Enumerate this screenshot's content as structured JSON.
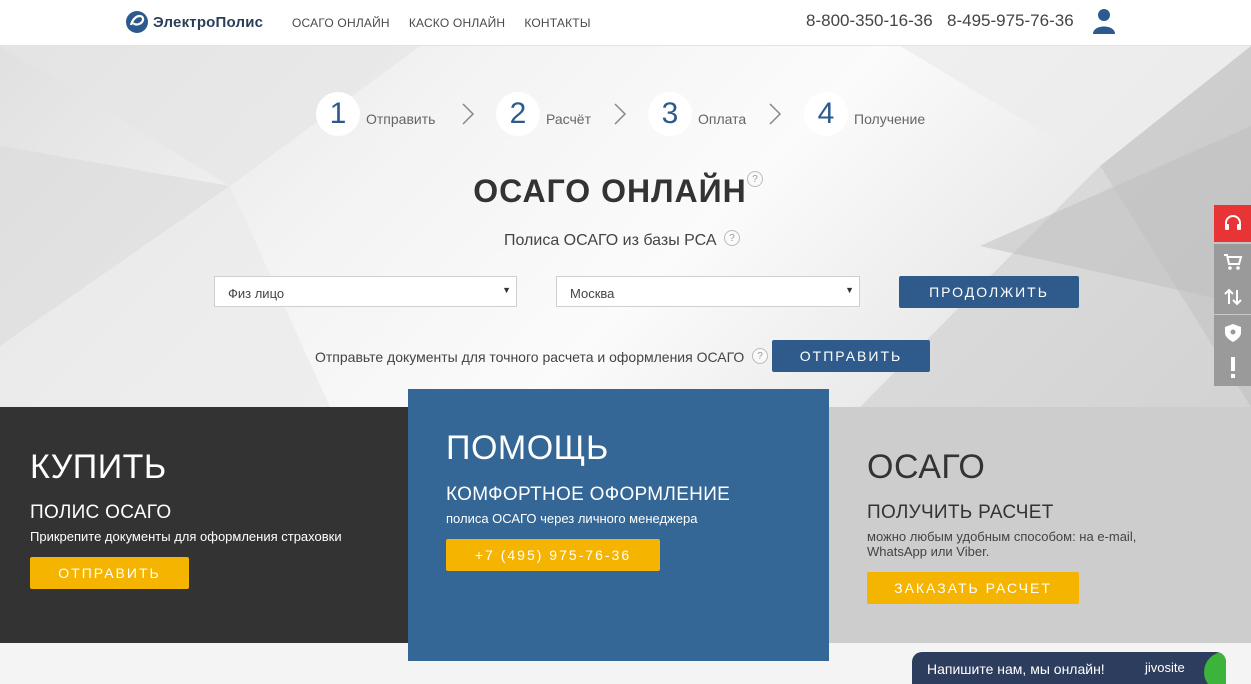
{
  "header": {
    "logo_text": "ЭлектроПолис",
    "nav": [
      "ОСАГО ОНЛАЙН",
      "КАСКО ОНЛАЙН",
      "КОНТАКТЫ"
    ],
    "phone1": "8-800-350-16-36",
    "phone2": "8-495-975-76-36"
  },
  "steps": [
    {
      "num": "1",
      "label": "Отправить"
    },
    {
      "num": "2",
      "label": "Расчёт"
    },
    {
      "num": "3",
      "label": "Оплата"
    },
    {
      "num": "4",
      "label": "Получение"
    }
  ],
  "hero": {
    "title": "ОСАГО ОНЛАЙН",
    "subtitle": "Полиса ОСАГО из базы РСА",
    "help_glyph": "?",
    "select_person": "Физ лицо",
    "select_city": "Москва",
    "continue_label": "ПРОДОЛЖИТЬ",
    "send_text": "Отправьте документы для точного расчета и оформления ОСАГО",
    "send_label": "ОТПРАВИТЬ"
  },
  "panels": {
    "buy": {
      "title": "КУПИТЬ",
      "subtitle": "ПОЛИС ОСАГО",
      "text": "Прикрепите документы для оформления страховки",
      "button": "ОТПРАВИТЬ"
    },
    "help": {
      "title": "ПОМОЩЬ",
      "subtitle": "КОМФОРТНОЕ ОФОРМЛЕНИЕ",
      "text": "полиса ОСАГО через личного менеджера",
      "button": "+7 (495) 975-76-36"
    },
    "osago": {
      "title": "ОСАГО",
      "subtitle": "ПОЛУЧИТЬ РАСЧЕТ",
      "text_line1": "можно любым удобным способом: на e-mail,",
      "text_line2": "WhatsApp или Viber.",
      "button": "ЗАКАЗАТЬ РАСЧЕТ"
    }
  },
  "chat": {
    "text": "Напишите нам, мы онлайн!",
    "brand": "jivosite"
  },
  "colors": {
    "primary_blue": "#2e5b8c",
    "accent_yellow": "#f5b400",
    "dark_panel": "#333333",
    "light_panel": "#cdcdcd",
    "red_badge": "#e93436"
  }
}
